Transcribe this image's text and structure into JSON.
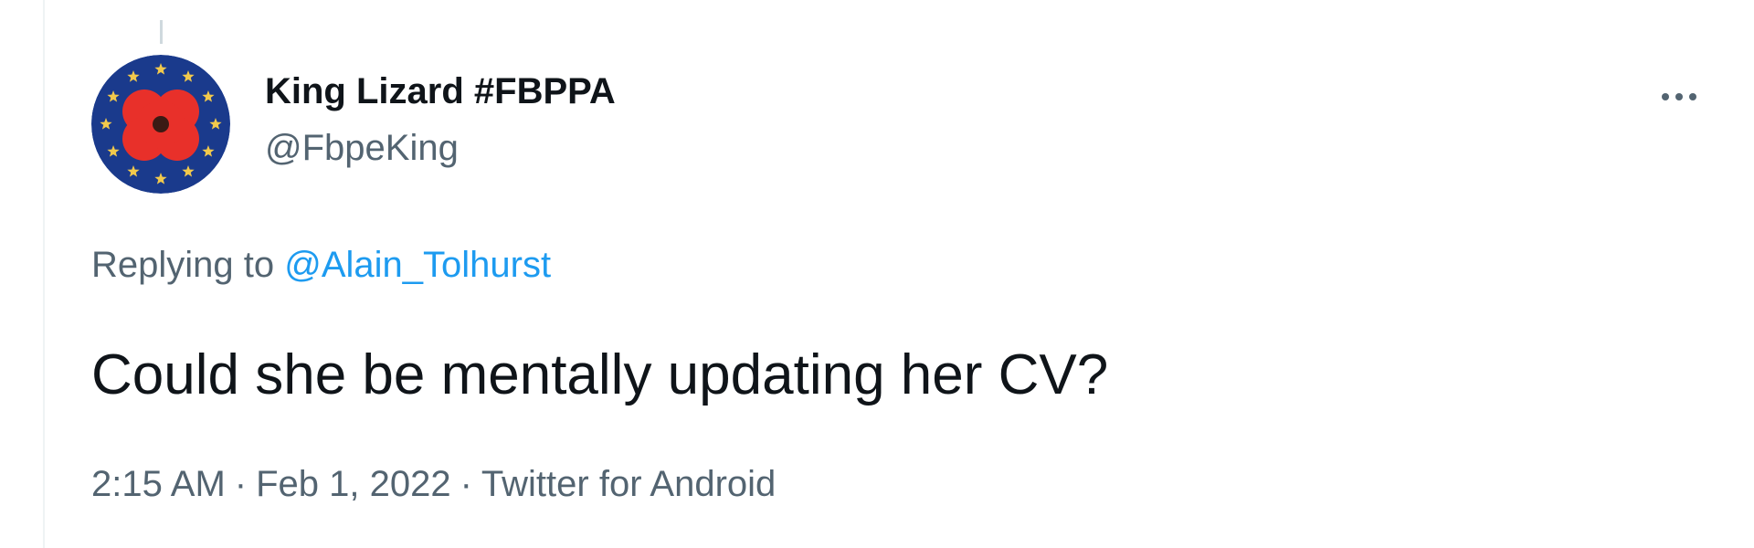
{
  "tweet": {
    "author": {
      "display_name": "King Lizard #FBPPA",
      "handle": "@FbpeKing",
      "avatar_icon": "eu-flag-poppy-icon",
      "avatar_colors": {
        "background": "#1a3a8c",
        "stars": "#f2c94c",
        "poppy": "#e8302a",
        "poppy_center": "#3a1a14"
      }
    },
    "more_icon": "more-dots-icon",
    "reply_prefix": "Replying to",
    "reply_mention": "@Alain_Tolhurst",
    "text": "Could she be mentally updating her CV?",
    "time": "2:15 AM",
    "separator": "·",
    "date": "Feb 1, 2022",
    "source": "Twitter for Android"
  },
  "colors": {
    "text_primary": "#0f1419",
    "text_secondary": "#536471",
    "link": "#1d9bf0",
    "border": "#eff3f4"
  }
}
